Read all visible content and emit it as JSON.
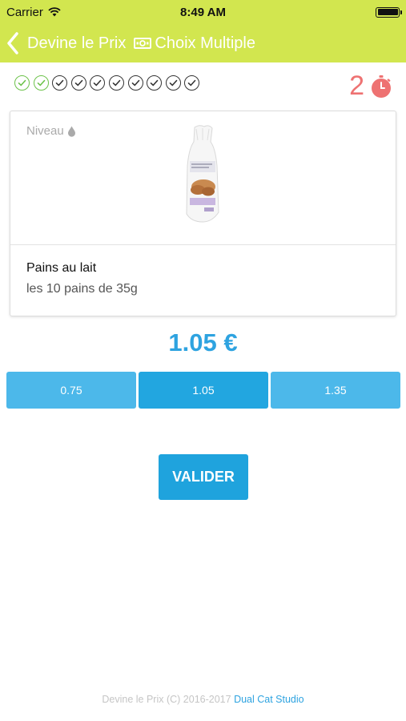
{
  "status_bar": {
    "carrier": "Carrier",
    "time": "8:49 AM"
  },
  "nav": {
    "back_label": "Devine le Prix",
    "title": "Choix Multiple",
    "color": "#d2e64f"
  },
  "progress": {
    "completed": 2,
    "total": 10
  },
  "timer": {
    "value": "2",
    "color": "#ee7272"
  },
  "product": {
    "level_label": "Niveau",
    "name": "Pains au lait",
    "description": "les 10 pains de 35g"
  },
  "price": {
    "display": "1.05 €",
    "color": "#2ea3e0"
  },
  "choices": [
    {
      "label": "0.75",
      "selected": false
    },
    {
      "label": "1.05",
      "selected": true
    },
    {
      "label": "1.35",
      "selected": false
    }
  ],
  "validate_label": "VALIDER",
  "footer": {
    "text": "Devine le Prix (C) 2016-2017",
    "link": "Dual Cat Studio"
  }
}
